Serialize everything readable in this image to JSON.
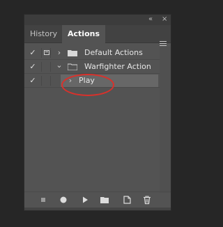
{
  "window": {
    "collapse_glyph": "«",
    "close_glyph": "×"
  },
  "tabs": [
    {
      "label": "History",
      "active": false
    },
    {
      "label": "Actions",
      "active": true
    }
  ],
  "panel_menu_icon": "hamburger-menu-icon",
  "rows": [
    {
      "checked": true,
      "check_glyph": "✓",
      "dialog_toggle": true,
      "expanded": false,
      "chevron": "›",
      "icon": "folder-icon",
      "label": "Default Actions",
      "selected": false
    },
    {
      "checked": true,
      "check_glyph": "✓",
      "dialog_toggle": false,
      "expanded": true,
      "chevron": "⌄",
      "icon": "folder-open-icon",
      "label": "Warfighter Action",
      "selected": false
    },
    {
      "checked": true,
      "check_glyph": "✓",
      "dialog_toggle": false,
      "expanded": false,
      "chevron": "›",
      "icon": "action-icon",
      "label": "Play",
      "selected": true
    }
  ],
  "footer": {
    "buttons": [
      {
        "name": "stop-button",
        "icon": "stop-icon"
      },
      {
        "name": "record-button",
        "icon": "record-icon"
      },
      {
        "name": "play-button",
        "icon": "play-icon"
      },
      {
        "name": "new-set-button",
        "icon": "folder-icon"
      },
      {
        "name": "new-action-button",
        "icon": "new-item-icon"
      },
      {
        "name": "delete-button",
        "icon": "trash-icon"
      }
    ]
  },
  "colors": {
    "background": "#262626",
    "panel": "#535353",
    "selection": "#676767",
    "annotation": "#d9312b"
  }
}
